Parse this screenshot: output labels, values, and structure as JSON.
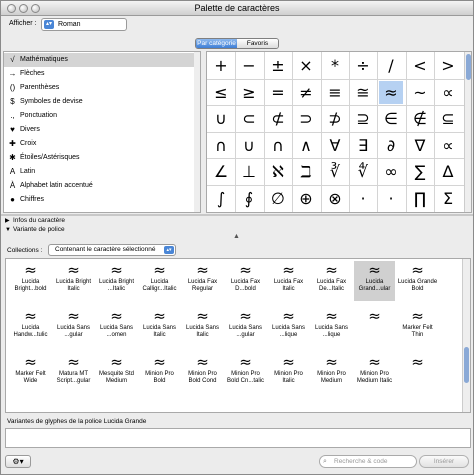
{
  "window": {
    "title": "Palette de caractères"
  },
  "toolbar": {
    "show_label": "Afficher :",
    "show_value": "Roman"
  },
  "tabs": [
    {
      "label": "Par catégorie",
      "selected": true
    },
    {
      "label": "Favoris",
      "selected": false
    }
  ],
  "categories": [
    {
      "icon": "√",
      "label": "Mathématiques",
      "selected": true
    },
    {
      "icon": "→",
      "label": "Flèches"
    },
    {
      "icon": "()",
      "label": "Parenthèses"
    },
    {
      "icon": "$",
      "label": "Symboles de devise"
    },
    {
      "icon": ".,",
      "label": "Ponctuation"
    },
    {
      "icon": "♥",
      "label": "Divers"
    },
    {
      "icon": "✚",
      "label": "Croix"
    },
    {
      "icon": "✱",
      "label": "Étoiles/Astérisques"
    },
    {
      "icon": "A",
      "label": "Latin"
    },
    {
      "icon": "À",
      "label": "Alphabet latin accentué"
    },
    {
      "icon": "●",
      "label": "Chiffres"
    }
  ],
  "chars": [
    [
      "+",
      "−",
      "±",
      "×",
      "*",
      "÷",
      "/",
      "<",
      ">"
    ],
    [
      "≤",
      "≥",
      "=",
      "≠",
      "≡",
      "≅",
      "≈",
      "~",
      "∝"
    ],
    [
      "∪",
      "⊂",
      "⊄",
      "⊃",
      "⊅",
      "⊇",
      "∈",
      "∉",
      "⊆"
    ],
    [
      "∩",
      "∪",
      "∩",
      "∧",
      "∀",
      "∃",
      "∂",
      "∇",
      "∝"
    ],
    [
      "∠",
      "⊥",
      "ℵ",
      "ℶ",
      "∛",
      "∜",
      "∞",
      "∑",
      "∆"
    ],
    [
      "∫",
      "∮",
      "∅",
      "⊕",
      "⊗",
      "·",
      "·",
      "∏",
      "Σ"
    ]
  ],
  "selected_char": {
    "row": 1,
    "col": 6
  },
  "disclosures": {
    "info": "Infos du caractère",
    "variant": "Variante de police"
  },
  "collections": {
    "label": "Collections :",
    "value": "Contenant le caractère sélectionné"
  },
  "font_glyph": "≈",
  "fonts": [
    [
      "Lucida Bright...bold",
      "Lucida Bright Italic",
      "Lucida Bright ...Italic",
      "Lucida Calligr...Italic",
      "Lucida Fax Regular",
      "Lucida Fax D...bold",
      "Lucida Fax Italic",
      "Lucida Fax De...Italic",
      "Lucida Grand...ular",
      "Lucida Grande Bold"
    ],
    [
      "Lucida Handw...tulic",
      "Lucida Sans ...gular",
      "Lucida Sans ...omen",
      "Lucida Sans Italic",
      "Lucida Sans Italic",
      "Lucida Sans ...gular",
      "Lucida Sans ...lique",
      "Lucida Sans ...lique",
      "",
      "Marker Felt Thin"
    ],
    [
      "Marker Felt Wide",
      "Matura MT Script...gular",
      "Mesquite Std Medium",
      "Minion Pro Bold",
      "Minion Pro Bold Cond",
      "Minion Pro Bold Cn...talic",
      "Minion Pro Italic",
      "Minion Pro Medium",
      "Minion Pro Medium Italic",
      ""
    ]
  ],
  "selected_font": {
    "row": 0,
    "col": 8
  },
  "variants": {
    "label": "Variantes de glyphes de la police Lucida Grande"
  },
  "bottom": {
    "gear": "⚙▾",
    "search_placeholder": "Recherche & code",
    "insert_label": "Insérer"
  }
}
